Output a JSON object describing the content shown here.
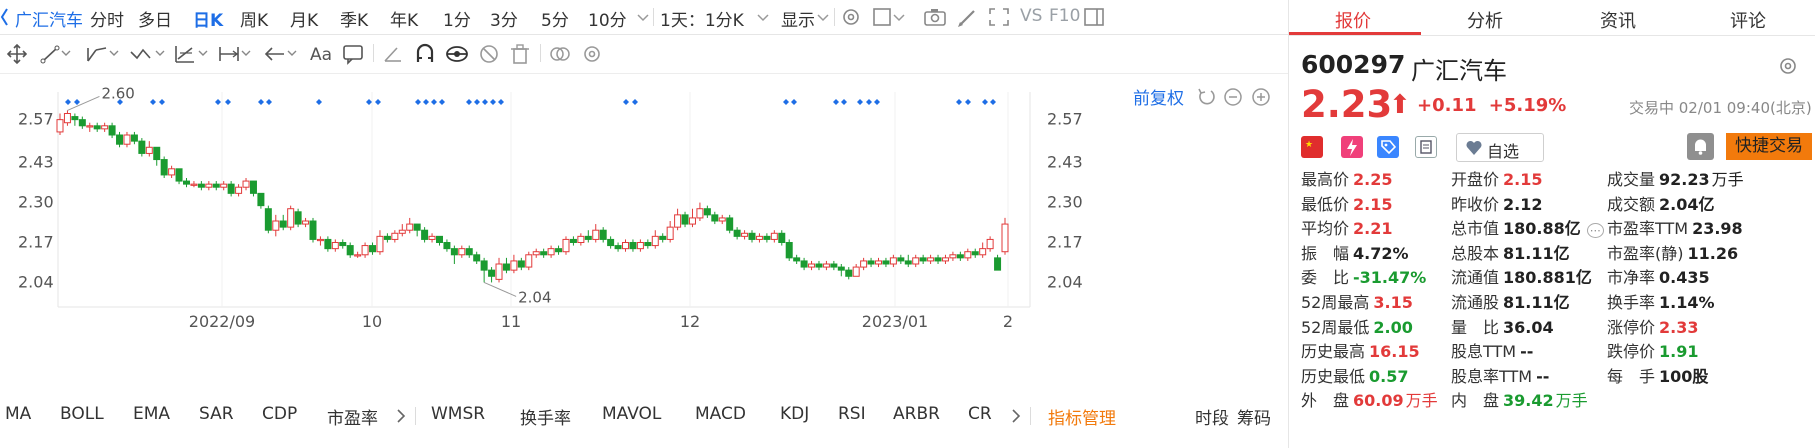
{
  "toolbar": {
    "stock_name": "广汇汽车",
    "periods": [
      "分时",
      "多日",
      "日K",
      "周K",
      "月K",
      "季K",
      "年K",
      "1分",
      "3分",
      "5分",
      "10分"
    ],
    "active_period": "日K",
    "interval_select": "1天：1分K",
    "display_label": "显示",
    "vs_label": "VS",
    "f10_label": "F10"
  },
  "draw_toolbar": {
    "font_tool_label": "Aa"
  },
  "chart": {
    "adjust_label": "前复权",
    "markers": {
      "high_label": "2.60",
      "low_label": "2.04"
    }
  },
  "chart_data": {
    "type": "candlestick",
    "y_ticks": [
      "2.57",
      "2.43",
      "2.30",
      "2.17",
      "2.04"
    ],
    "y_range": [
      1.96,
      2.66
    ],
    "x_ticks": [
      "2022/09",
      "10",
      "11",
      "12",
      "2023/01",
      "2"
    ],
    "high_annotation": 2.6,
    "low_annotation": 2.04,
    "candles": [
      {
        "o": 2.53,
        "c": 2.57,
        "h": 2.59,
        "l": 2.52
      },
      {
        "o": 2.56,
        "c": 2.59,
        "h": 2.6,
        "l": 2.55
      },
      {
        "o": 2.58,
        "c": 2.57,
        "h": 2.59,
        "l": 2.55
      },
      {
        "o": 2.57,
        "c": 2.55,
        "h": 2.58,
        "l": 2.54
      },
      {
        "o": 2.55,
        "c": 2.55,
        "h": 2.56,
        "l": 2.53
      },
      {
        "o": 2.55,
        "c": 2.54,
        "h": 2.56,
        "l": 2.53
      },
      {
        "o": 2.54,
        "c": 2.55,
        "h": 2.56,
        "l": 2.53
      },
      {
        "o": 2.55,
        "c": 2.52,
        "h": 2.56,
        "l": 2.51
      },
      {
        "o": 2.52,
        "c": 2.49,
        "h": 2.53,
        "l": 2.48
      },
      {
        "o": 2.49,
        "c": 2.52,
        "h": 2.53,
        "l": 2.48
      },
      {
        "o": 2.52,
        "c": 2.5,
        "h": 2.53,
        "l": 2.49
      },
      {
        "o": 2.5,
        "c": 2.46,
        "h": 2.51,
        "l": 2.45
      },
      {
        "o": 2.46,
        "c": 2.48,
        "h": 2.5,
        "l": 2.45
      },
      {
        "o": 2.48,
        "c": 2.44,
        "h": 2.48,
        "l": 2.42
      },
      {
        "o": 2.44,
        "c": 2.39,
        "h": 2.45,
        "l": 2.38
      },
      {
        "o": 2.39,
        "c": 2.41,
        "h": 2.42,
        "l": 2.38
      },
      {
        "o": 2.41,
        "c": 2.37,
        "h": 2.41,
        "l": 2.36
      },
      {
        "o": 2.37,
        "c": 2.36,
        "h": 2.38,
        "l": 2.35
      },
      {
        "o": 2.36,
        "c": 2.36,
        "h": 2.37,
        "l": 2.35
      },
      {
        "o": 2.36,
        "c": 2.35,
        "h": 2.37,
        "l": 2.34
      },
      {
        "o": 2.35,
        "c": 2.36,
        "h": 2.37,
        "l": 2.34
      },
      {
        "o": 2.36,
        "c": 2.35,
        "h": 2.37,
        "l": 2.34
      },
      {
        "o": 2.35,
        "c": 2.36,
        "h": 2.37,
        "l": 2.34
      },
      {
        "o": 2.36,
        "c": 2.33,
        "h": 2.37,
        "l": 2.32
      },
      {
        "o": 2.33,
        "c": 2.35,
        "h": 2.36,
        "l": 2.32
      },
      {
        "o": 2.35,
        "c": 2.37,
        "h": 2.38,
        "l": 2.34
      },
      {
        "o": 2.37,
        "c": 2.33,
        "h": 2.37,
        "l": 2.32
      },
      {
        "o": 2.33,
        "c": 2.29,
        "h": 2.33,
        "l": 2.28
      },
      {
        "o": 2.28,
        "c": 2.21,
        "h": 2.29,
        "l": 2.2
      },
      {
        "o": 2.21,
        "c": 2.24,
        "h": 2.26,
        "l": 2.19
      },
      {
        "o": 2.24,
        "c": 2.22,
        "h": 2.26,
        "l": 2.21
      },
      {
        "o": 2.22,
        "c": 2.28,
        "h": 2.29,
        "l": 2.21
      },
      {
        "o": 2.27,
        "c": 2.23,
        "h": 2.28,
        "l": 2.22
      },
      {
        "o": 2.23,
        "c": 2.24,
        "h": 2.25,
        "l": 2.22
      },
      {
        "o": 2.24,
        "c": 2.18,
        "h": 2.25,
        "l": 2.17
      },
      {
        "o": 2.18,
        "c": 2.18,
        "h": 2.19,
        "l": 2.16
      },
      {
        "o": 2.18,
        "c": 2.15,
        "h": 2.19,
        "l": 2.14
      },
      {
        "o": 2.15,
        "c": 2.17,
        "h": 2.18,
        "l": 2.14
      },
      {
        "o": 2.17,
        "c": 2.16,
        "h": 2.18,
        "l": 2.15
      },
      {
        "o": 2.16,
        "c": 2.13,
        "h": 2.17,
        "l": 2.12
      },
      {
        "o": 2.13,
        "c": 2.13,
        "h": 2.14,
        "l": 2.12
      },
      {
        "o": 2.13,
        "c": 2.16,
        "h": 2.17,
        "l": 2.12
      },
      {
        "o": 2.16,
        "c": 2.14,
        "h": 2.17,
        "l": 2.13
      },
      {
        "o": 2.14,
        "c": 2.19,
        "h": 2.21,
        "l": 2.13
      },
      {
        "o": 2.19,
        "c": 2.18,
        "h": 2.2,
        "l": 2.17
      },
      {
        "o": 2.18,
        "c": 2.2,
        "h": 2.21,
        "l": 2.17
      },
      {
        "o": 2.2,
        "c": 2.21,
        "h": 2.23,
        "l": 2.19
      },
      {
        "o": 2.21,
        "c": 2.23,
        "h": 2.25,
        "l": 2.2
      },
      {
        "o": 2.23,
        "c": 2.21,
        "h": 2.23,
        "l": 2.19
      },
      {
        "o": 2.21,
        "c": 2.18,
        "h": 2.22,
        "l": 2.17
      },
      {
        "o": 2.18,
        "c": 2.19,
        "h": 2.2,
        "l": 2.17
      },
      {
        "o": 2.19,
        "c": 2.17,
        "h": 2.19,
        "l": 2.16
      },
      {
        "o": 2.17,
        "c": 2.15,
        "h": 2.18,
        "l": 2.14
      },
      {
        "o": 2.15,
        "c": 2.13,
        "h": 2.16,
        "l": 2.1
      },
      {
        "o": 2.13,
        "c": 2.15,
        "h": 2.16,
        "l": 2.12
      },
      {
        "o": 2.15,
        "c": 2.13,
        "h": 2.16,
        "l": 2.12
      },
      {
        "o": 2.13,
        "c": 2.11,
        "h": 2.14,
        "l": 2.1
      },
      {
        "o": 2.11,
        "c": 2.08,
        "h": 2.12,
        "l": 2.04
      },
      {
        "o": 2.08,
        "c": 2.06,
        "h": 2.09,
        "l": 2.04
      },
      {
        "o": 2.05,
        "c": 2.1,
        "h": 2.12,
        "l": 2.04
      },
      {
        "o": 2.1,
        "c": 2.08,
        "h": 2.12,
        "l": 2.07
      },
      {
        "o": 2.08,
        "c": 2.11,
        "h": 2.13,
        "l": 2.07
      },
      {
        "o": 2.11,
        "c": 2.09,
        "h": 2.12,
        "l": 2.08
      },
      {
        "o": 2.09,
        "c": 2.13,
        "h": 2.14,
        "l": 2.08
      },
      {
        "o": 2.13,
        "c": 2.14,
        "h": 2.15,
        "l": 2.12
      },
      {
        "o": 2.14,
        "c": 2.13,
        "h": 2.15,
        "l": 2.12
      },
      {
        "o": 2.13,
        "c": 2.15,
        "h": 2.16,
        "l": 2.12
      },
      {
        "o": 2.15,
        "c": 2.14,
        "h": 2.16,
        "l": 2.13
      },
      {
        "o": 2.14,
        "c": 2.18,
        "h": 2.19,
        "l": 2.13
      },
      {
        "o": 2.18,
        "c": 2.17,
        "h": 2.19,
        "l": 2.16
      },
      {
        "o": 2.17,
        "c": 2.19,
        "h": 2.2,
        "l": 2.16
      },
      {
        "o": 2.19,
        "c": 2.18,
        "h": 2.21,
        "l": 2.17
      },
      {
        "o": 2.18,
        "c": 2.21,
        "h": 2.23,
        "l": 2.17
      },
      {
        "o": 2.21,
        "c": 2.18,
        "h": 2.22,
        "l": 2.17
      },
      {
        "o": 2.18,
        "c": 2.16,
        "h": 2.19,
        "l": 2.15
      },
      {
        "o": 2.16,
        "c": 2.15,
        "h": 2.17,
        "l": 2.14
      },
      {
        "o": 2.15,
        "c": 2.17,
        "h": 2.18,
        "l": 2.14
      },
      {
        "o": 2.17,
        "c": 2.15,
        "h": 2.18,
        "l": 2.14
      },
      {
        "o": 2.15,
        "c": 2.17,
        "h": 2.18,
        "l": 2.14
      },
      {
        "o": 2.17,
        "c": 2.16,
        "h": 2.18,
        "l": 2.15
      },
      {
        "o": 2.16,
        "c": 2.19,
        "h": 2.21,
        "l": 2.15
      },
      {
        "o": 2.19,
        "c": 2.18,
        "h": 2.2,
        "l": 2.17
      },
      {
        "o": 2.18,
        "c": 2.22,
        "h": 2.24,
        "l": 2.17
      },
      {
        "o": 2.22,
        "c": 2.26,
        "h": 2.28,
        "l": 2.21
      },
      {
        "o": 2.26,
        "c": 2.23,
        "h": 2.27,
        "l": 2.22
      },
      {
        "o": 2.23,
        "c": 2.25,
        "h": 2.28,
        "l": 2.22
      },
      {
        "o": 2.25,
        "c": 2.28,
        "h": 2.3,
        "l": 2.24
      },
      {
        "o": 2.28,
        "c": 2.26,
        "h": 2.29,
        "l": 2.25
      },
      {
        "o": 2.26,
        "c": 2.24,
        "h": 2.27,
        "l": 2.23
      },
      {
        "o": 2.24,
        "c": 2.25,
        "h": 2.26,
        "l": 2.23
      },
      {
        "o": 2.25,
        "c": 2.21,
        "h": 2.26,
        "l": 2.2
      },
      {
        "o": 2.21,
        "c": 2.19,
        "h": 2.22,
        "l": 2.18
      },
      {
        "o": 2.19,
        "c": 2.2,
        "h": 2.21,
        "l": 2.18
      },
      {
        "o": 2.2,
        "c": 2.18,
        "h": 2.21,
        "l": 2.17
      },
      {
        "o": 2.18,
        "c": 2.19,
        "h": 2.2,
        "l": 2.17
      },
      {
        "o": 2.19,
        "c": 2.18,
        "h": 2.2,
        "l": 2.17
      },
      {
        "o": 2.18,
        "c": 2.2,
        "h": 2.21,
        "l": 2.17
      },
      {
        "o": 2.2,
        "c": 2.17,
        "h": 2.21,
        "l": 2.16
      },
      {
        "o": 2.17,
        "c": 2.12,
        "h": 2.18,
        "l": 2.11
      },
      {
        "o": 2.12,
        "c": 2.11,
        "h": 2.13,
        "l": 2.1
      },
      {
        "o": 2.11,
        "c": 2.09,
        "h": 2.12,
        "l": 2.08
      },
      {
        "o": 2.09,
        "c": 2.1,
        "h": 2.11,
        "l": 2.08
      },
      {
        "o": 2.1,
        "c": 2.09,
        "h": 2.11,
        "l": 2.08
      },
      {
        "o": 2.09,
        "c": 2.1,
        "h": 2.11,
        "l": 2.08
      },
      {
        "o": 2.1,
        "c": 2.09,
        "h": 2.11,
        "l": 2.08
      },
      {
        "o": 2.09,
        "c": 2.08,
        "h": 2.1,
        "l": 2.06
      },
      {
        "o": 2.08,
        "c": 2.06,
        "h": 2.09,
        "l": 2.05
      },
      {
        "o": 2.06,
        "c": 2.09,
        "h": 2.1,
        "l": 2.06
      },
      {
        "o": 2.09,
        "c": 2.11,
        "h": 2.12,
        "l": 2.08
      },
      {
        "o": 2.11,
        "c": 2.1,
        "h": 2.12,
        "l": 2.09
      },
      {
        "o": 2.1,
        "c": 2.11,
        "h": 2.12,
        "l": 2.09
      },
      {
        "o": 2.11,
        "c": 2.1,
        "h": 2.12,
        "l": 2.09
      },
      {
        "o": 2.1,
        "c": 2.12,
        "h": 2.13,
        "l": 2.09
      },
      {
        "o": 2.12,
        "c": 2.11,
        "h": 2.13,
        "l": 2.1
      },
      {
        "o": 2.11,
        "c": 2.1,
        "h": 2.13,
        "l": 2.09
      },
      {
        "o": 2.1,
        "c": 2.12,
        "h": 2.13,
        "l": 2.09
      },
      {
        "o": 2.12,
        "c": 2.11,
        "h": 2.13,
        "l": 2.1
      },
      {
        "o": 2.11,
        "c": 2.12,
        "h": 2.13,
        "l": 2.1
      },
      {
        "o": 2.12,
        "c": 2.11,
        "h": 2.13,
        "l": 2.1
      },
      {
        "o": 2.11,
        "c": 2.12,
        "h": 2.13,
        "l": 2.1
      },
      {
        "o": 2.12,
        "c": 2.13,
        "h": 2.14,
        "l": 2.11
      },
      {
        "o": 2.13,
        "c": 2.12,
        "h": 2.14,
        "l": 2.11
      },
      {
        "o": 2.12,
        "c": 2.14,
        "h": 2.15,
        "l": 2.11
      },
      {
        "o": 2.14,
        "c": 2.13,
        "h": 2.15,
        "l": 2.12
      },
      {
        "o": 2.13,
        "c": 2.15,
        "h": 2.17,
        "l": 2.12
      },
      {
        "o": 2.15,
        "c": 2.18,
        "h": 2.19,
        "l": 2.14
      },
      {
        "o": 2.12,
        "c": 2.08,
        "h": 2.13,
        "l": 2.08
      },
      {
        "o": 2.14,
        "c": 2.23,
        "h": 2.25,
        "l": 2.13
      }
    ]
  },
  "indicators": {
    "items": [
      "MA",
      "BOLL",
      "EMA",
      "SAR",
      "CDP",
      "市盈率",
      "WMSR",
      "换手率",
      "MAVOL",
      "MACD",
      "KDJ",
      "RSI",
      "ARBR",
      "CR"
    ],
    "manage_label": "指标管理",
    "tab_timeshare": "时段",
    "tab_chips": "筹码"
  },
  "right_panel": {
    "tabs": [
      "报价",
      "分析",
      "资讯",
      "评论"
    ],
    "active_tab": "报价",
    "code": "600297",
    "name": "广汇汽车",
    "price": "2.23",
    "change": "+0.11",
    "change_pct": "+5.19%",
    "status": "交易中 02/01 09:40(北京)",
    "watch_label": "自选",
    "trade_label": "快捷交易",
    "quote_col1": [
      {
        "label": "最高价",
        "value": "2.25",
        "color": "red"
      },
      {
        "label": "最低价",
        "value": "2.15",
        "color": "red"
      },
      {
        "label": "平均价",
        "value": "2.21",
        "color": "red"
      },
      {
        "label": "振　幅",
        "value": "4.72%",
        "color": "dark"
      },
      {
        "label": "委　比",
        "value": "-31.47%",
        "color": "green"
      },
      {
        "label": "52周最高",
        "value": "3.15",
        "color": "red"
      },
      {
        "label": "52周最低",
        "value": "2.00",
        "color": "green"
      },
      {
        "label": "历史最高",
        "value": "16.15",
        "color": "red"
      },
      {
        "label": "历史最低",
        "value": "0.57",
        "color": "green"
      },
      {
        "label": "外　盘",
        "value": "60.09",
        "unit": "万手",
        "color": "red"
      }
    ],
    "quote_col2": [
      {
        "label": "开盘价",
        "value": "2.15",
        "color": "red"
      },
      {
        "label": "昨收价",
        "value": "2.12",
        "color": "dark"
      },
      {
        "label": "总市值",
        "value": "180.88亿",
        "color": "dark"
      },
      {
        "label": "总股本",
        "value": "81.11亿",
        "color": "dark"
      },
      {
        "label": "流通值",
        "value": "180.881亿",
        "color": "dark"
      },
      {
        "label": "流通股",
        "value": "81.11亿",
        "color": "dark"
      },
      {
        "label": "量　比",
        "value": "36.04",
        "color": "dark"
      },
      {
        "label": "股息TTM",
        "value": "--",
        "color": "dark"
      },
      {
        "label": "股息率TTM",
        "value": "--",
        "color": "dark"
      },
      {
        "label": "内　盘",
        "value": "39.42",
        "unit": "万手",
        "color": "green"
      }
    ],
    "quote_col3": [
      {
        "label": "成交量",
        "value": "92.23",
        "unit": "万手",
        "color": "dark"
      },
      {
        "label": "成交额",
        "value": "2.04亿",
        "color": "dark"
      },
      {
        "label": "市盈率TTM",
        "value": "23.98",
        "color": "dark"
      },
      {
        "label": "市盈率(静)",
        "value": "11.26",
        "color": "dark"
      },
      {
        "label": "市净率",
        "value": "0.435",
        "color": "dark"
      },
      {
        "label": "换手率",
        "value": "1.14%",
        "color": "dark"
      },
      {
        "label": "涨停价",
        "value": "2.33",
        "color": "red"
      },
      {
        "label": "跌停价",
        "value": "1.91",
        "color": "green"
      },
      {
        "label": "每　手",
        "value": "100股",
        "color": "dark"
      }
    ],
    "colors": {
      "up": "#e23a3a",
      "down": "#1a9b30",
      "accent": "#1e6ee6",
      "orange": "#f27a0c"
    }
  }
}
